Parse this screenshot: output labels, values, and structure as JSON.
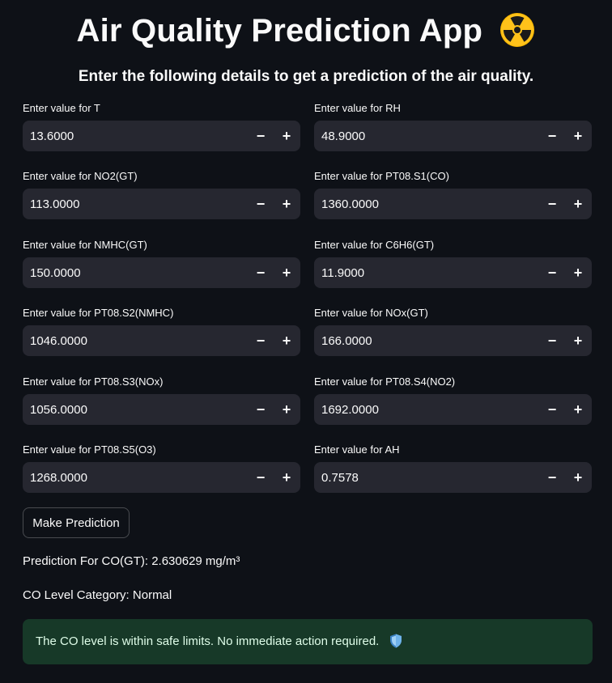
{
  "header": {
    "title": "Air Quality Prediction App",
    "title_icon": "radioactive-icon",
    "subtitle": "Enter the following details to get a prediction of the air quality."
  },
  "fields": [
    {
      "label": "Enter value for T",
      "value": "13.6000"
    },
    {
      "label": "Enter value for RH",
      "value": "48.9000"
    },
    {
      "label": "Enter value for NO2(GT)",
      "value": "113.0000"
    },
    {
      "label": "Enter value for PT08.S1(CO)",
      "value": "1360.0000"
    },
    {
      "label": "Enter value for NMHC(GT)",
      "value": "150.0000"
    },
    {
      "label": "Enter value for C6H6(GT)",
      "value": "11.9000"
    },
    {
      "label": "Enter value for PT08.S2(NMHC)",
      "value": "1046.0000"
    },
    {
      "label": "Enter value for NOx(GT)",
      "value": "166.0000"
    },
    {
      "label": "Enter value for PT08.S3(NOx)",
      "value": "1056.0000"
    },
    {
      "label": "Enter value for PT08.S4(NO2)",
      "value": "1692.0000"
    },
    {
      "label": "Enter value for PT08.S5(O3)",
      "value": "1268.0000"
    },
    {
      "label": "Enter value for AH",
      "value": "0.7578"
    }
  ],
  "stepper": {
    "minus": "−",
    "plus": "+"
  },
  "actions": {
    "predict_label": "Make Prediction"
  },
  "results": {
    "prediction_text": "Prediction For CO(GT): 2.630629 mg/m³",
    "category_text": "CO Level Category: Normal",
    "alert_text": "The CO level is within safe limits. No immediate action required.",
    "alert_icon": "shield-icon"
  },
  "colors": {
    "background": "#0e1117",
    "input_bg": "#262730",
    "success_bg": "#173928",
    "success_text": "#dffde9"
  }
}
